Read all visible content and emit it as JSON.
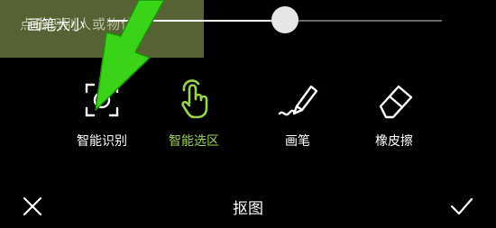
{
  "tooltip": {
    "text": "点击识别人或物体"
  },
  "brush_size": {
    "label": "画笔大小",
    "value_fraction": 0.53
  },
  "tools": [
    {
      "label": "智能识别",
      "icon": "smart-recognize-icon"
    },
    {
      "label": "智能选区",
      "icon": "tap-hand-icon"
    },
    {
      "label": "画笔",
      "icon": "brush-icon"
    },
    {
      "label": "橡皮擦",
      "icon": "eraser-icon"
    }
  ],
  "active_tool": "智能选区",
  "bottom": {
    "title": "抠图",
    "cancel_icon": "close-icon",
    "confirm_icon": "check-icon"
  },
  "colors": {
    "accent": "#9bd44a",
    "tooltip_bg": "#5e6a38",
    "arrow": "#39d318",
    "background": "#000000"
  }
}
